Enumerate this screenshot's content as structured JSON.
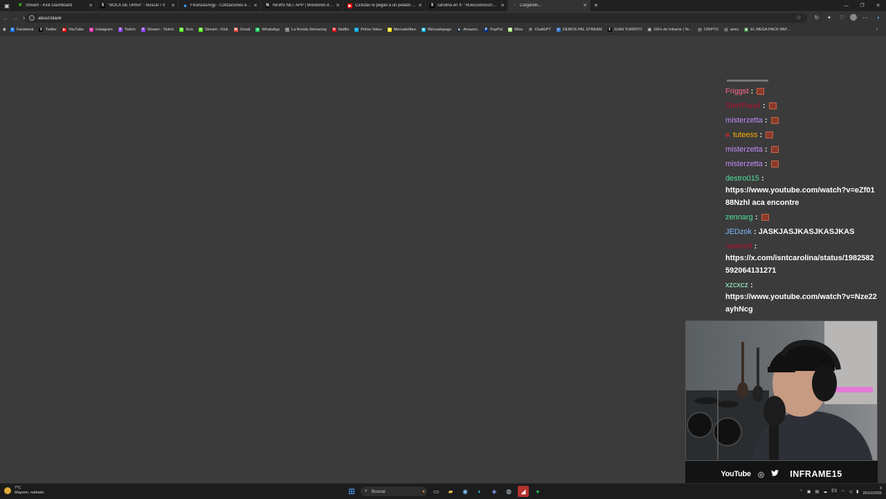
{
  "tabs": [
    {
      "title": "Stream - Kick Dashboard",
      "fav": "K",
      "fav_color": "#53fc18",
      "fav_bg": "#1d1d1d",
      "active": false
    },
    {
      "title": "\"BOCA DE URNA\" - Buscar / X",
      "fav": "X",
      "fav_color": "#ffffff",
      "fav_bg": "#000000",
      "active": false
    },
    {
      "title": "FinanzasArgy - Cotizaciones en tiempo real",
      "fav": "◆",
      "fav_color": "#3aa0ff",
      "fav_bg": "transparent",
      "active": false
    },
    {
      "title": "NEWS NET APP | Monitoreo de medios",
      "fav": "N",
      "fav_color": "#ffffff",
      "fav_bg": "#111111",
      "active": false
    },
    {
      "title": "Ciclistas le pegan a un pelado - YouTube",
      "fav": "▶",
      "fav_color": "#ffffff",
      "fav_bg": "#ff0000",
      "active": false
    },
    {
      "title": "carolina en X: \"#Elecciones2025\"",
      "fav": "X",
      "fav_color": "#ffffff",
      "fav_bg": "#000000",
      "active": false
    },
    {
      "title": "Cargando...",
      "fav": "·",
      "fav_color": "#bbbbbb",
      "fav_bg": "transparent",
      "active": true
    }
  ],
  "address": {
    "url": "about:blank"
  },
  "bookmarks": [
    {
      "label": "Facebook",
      "color": "#1877f2",
      "glyph": "f"
    },
    {
      "label": "Twitter",
      "color": "#000000",
      "glyph": "X"
    },
    {
      "label": "YouTube",
      "color": "#ff0000",
      "glyph": "▶"
    },
    {
      "label": "Instagram",
      "color": "#d6249f",
      "glyph": "◎"
    },
    {
      "label": "Twitch",
      "color": "#9146ff",
      "glyph": "T"
    },
    {
      "label": "Stream - Twitch",
      "color": "#9146ff",
      "glyph": "T"
    },
    {
      "label": "Kick",
      "color": "#53fc18",
      "glyph": "K"
    },
    {
      "label": "Stream - Kick",
      "color": "#53fc18",
      "glyph": "K"
    },
    {
      "label": "Gmail",
      "color": "#ea4335",
      "glyph": "M"
    },
    {
      "label": "WhatsApp",
      "color": "#25d366",
      "glyph": "●"
    },
    {
      "label": "La Ronda Simracing",
      "color": "#888888",
      "glyph": "◔"
    },
    {
      "label": "Netflix",
      "color": "#e50914",
      "glyph": "N"
    },
    {
      "label": "Prime Video",
      "color": "#00a8e1",
      "glyph": "▷"
    },
    {
      "label": "Mercadolibre",
      "color": "#ffe600",
      "glyph": "◉"
    },
    {
      "label": "Mercadopago",
      "color": "#00b1ea",
      "glyph": "◉"
    },
    {
      "label": "Amazon.",
      "color": "#232f3e",
      "glyph": "a"
    },
    {
      "label": "PayPal",
      "color": "#003087",
      "glyph": "P"
    },
    {
      "label": "Wise",
      "color": "#9fe870",
      "glyph": "W"
    },
    {
      "label": "ChatGPT",
      "color": "#444444",
      "glyph": "✳"
    },
    {
      "label": "DEMOS PAL STREAM",
      "color": "#3a7bd5",
      "glyph": "✔"
    },
    {
      "label": "JUAN TURRITO",
      "color": "#000000",
      "glyph": "X"
    },
    {
      "label": "GIFs de Inframe | Te...",
      "color": "#444444",
      "glyph": "▦"
    },
    {
      "label": "CRIPTO",
      "color": "#555555",
      "glyph": "▭"
    },
    {
      "label": "aires",
      "color": "#555555",
      "glyph": "▭"
    },
    {
      "label": "EL MEGA PACK PAP...",
      "color": "#2e7d32",
      "glyph": "▦"
    }
  ],
  "chat": {
    "messages": [
      {
        "user": "Friggst",
        "user_color": "#ff6b8a",
        "text": "",
        "emote": true,
        "badge": false
      },
      {
        "user": "ShirtPanel",
        "user_color": "#b0122e",
        "text": "",
        "emote": true,
        "badge": false
      },
      {
        "user": "misterzetta",
        "user_color": "#c58cff",
        "text": "",
        "emote": true,
        "badge": false
      },
      {
        "user": "tuteess",
        "user_color": "#ffb000",
        "text": "",
        "emote": true,
        "badge": true
      },
      {
        "user": "misterzetta",
        "user_color": "#c58cff",
        "text": "",
        "emote": true,
        "badge": false
      },
      {
        "user": "misterzetta",
        "user_color": "#c58cff",
        "text": "",
        "emote": true,
        "badge": false
      },
      {
        "user": "destro015",
        "user_color": "#4fe0a0",
        "text": "https://www.youtube.com/watch?v=eZf0188Nzhl aca encontre",
        "emote": false,
        "badge": false
      },
      {
        "user": "zennarg",
        "user_color": "#4fe0a0",
        "text": "",
        "emote": true,
        "badge": false
      },
      {
        "user": "JEDzok",
        "user_color": "#7fb8ff",
        "text": "JASKJASJKASJKASJKAS",
        "emote": false,
        "badge": false
      },
      {
        "user": "nawee8",
        "user_color": "#b0122e",
        "text": "https://x.com/isntcarolina/status/1982582592064131271",
        "emote": false,
        "badge": false
      },
      {
        "user": "xzcxcz",
        "user_color": "#9ff7c9",
        "text": "https://www.youtube.com/watch?v=Nze22ayhNcg",
        "emote": false,
        "badge": false
      }
    ]
  },
  "cam_banner": {
    "youtube": "YouTube",
    "handle": "INFRAME15"
  },
  "taskbar": {
    "weather_temp": "7°C",
    "weather_desc": "Mayorm. nublado",
    "search_placeholder": "Buscar",
    "lang": "ES",
    "time": "3",
    "date": "26/10/2025"
  }
}
